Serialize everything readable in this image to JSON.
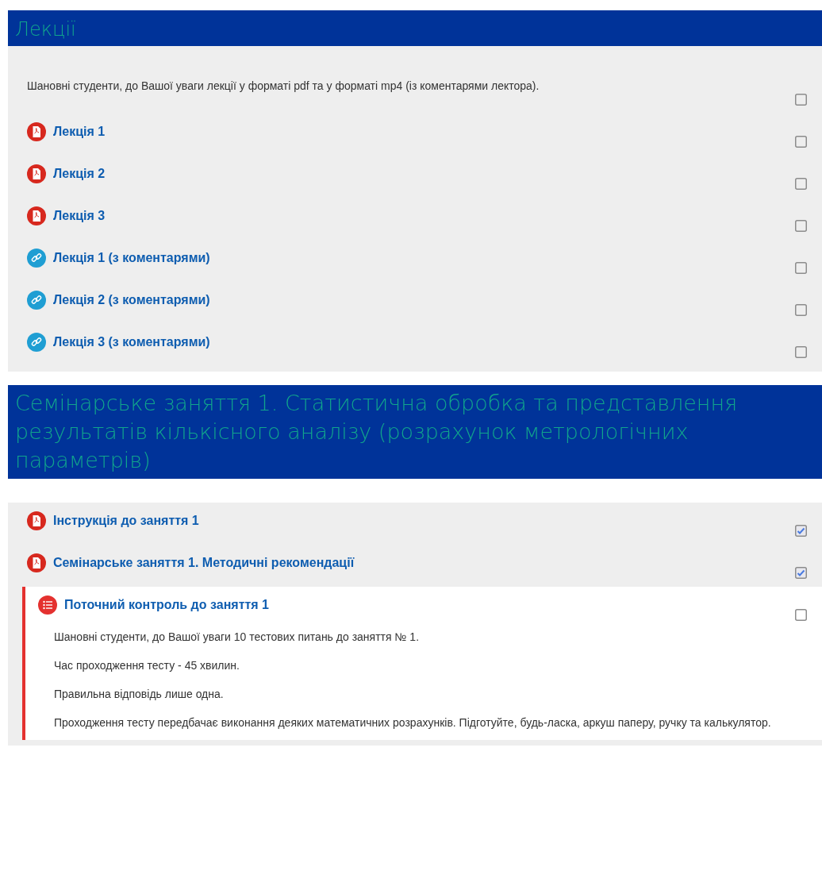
{
  "sections": [
    {
      "title": "Лекції",
      "items": [
        {
          "kind": "text",
          "label": "Шановні студенти, до Вашої уваги лекції у форматі pdf та у форматі mp4 (із коментарями лектора).",
          "checked": false,
          "highlighted": false
        },
        {
          "kind": "pdf",
          "label": "Лекція 1",
          "checked": false,
          "highlighted": false
        },
        {
          "kind": "pdf",
          "label": "Лекція 2",
          "checked": false,
          "highlighted": false
        },
        {
          "kind": "pdf",
          "label": "Лекція 3",
          "checked": false,
          "highlighted": false
        },
        {
          "kind": "url",
          "label": "Лекція 1 (з коментарями)",
          "checked": false,
          "highlighted": false
        },
        {
          "kind": "url",
          "label": "Лекція 2 (з коментарями)",
          "checked": false,
          "highlighted": false
        },
        {
          "kind": "url",
          "label": "Лекція 3 (з коментарями)",
          "checked": false,
          "highlighted": false
        }
      ]
    },
    {
      "title": "Семінарське заняття 1. Статистична обробка та представлення результатів кількісного аналізу (розрахунок метрологічних параметрів)",
      "items": [
        {
          "kind": "pdf",
          "label": "Інструкція до заняття 1",
          "checked": true,
          "highlighted": false
        },
        {
          "kind": "pdf",
          "label": "Семінарське заняття 1. Методичні рекомендації",
          "checked": true,
          "highlighted": false
        },
        {
          "kind": "quiz",
          "label": "Поточний контроль до заняття 1",
          "checked": false,
          "highlighted": true,
          "description": [
            "Шановні студенти, до Вашої уваги 10 тестових питань до заняття № 1.",
            "Час проходження тесту - 45 хвилин.",
            "Правильна відповідь лише одна.",
            "Проходження тесту передбачає виконання деяких математичних розрахунків. Підготуйте, будь-ласка, аркуш паперу, ручку та калькулятор."
          ]
        }
      ]
    }
  ]
}
